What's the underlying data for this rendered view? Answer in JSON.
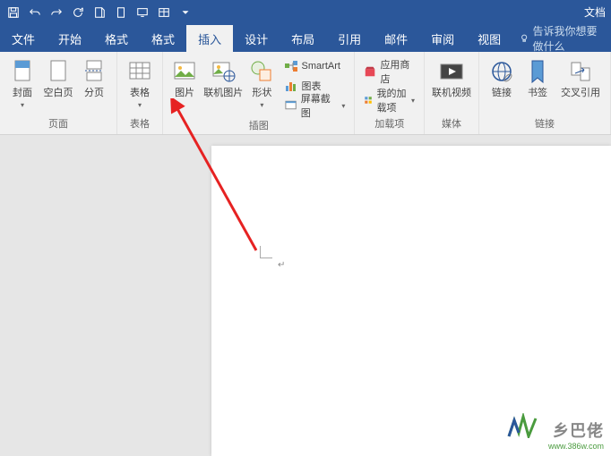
{
  "qat": {
    "doc_name": "文档"
  },
  "tabs": {
    "file": "文件",
    "start": "开始",
    "fmt1": "格式",
    "fmt2": "格式",
    "insert": "插入",
    "design": "设计",
    "layout": "布局",
    "ref": "引用",
    "mail": "邮件",
    "review": "审阅",
    "view": "视图",
    "tellme": "告诉我你想要做什么"
  },
  "ribbon": {
    "pages": {
      "cover": "封面",
      "blank": "空白页",
      "break": "分页",
      "label": "页面"
    },
    "table": {
      "btn": "表格",
      "label": "表格"
    },
    "illus": {
      "pic": "图片",
      "online": "联机图片",
      "shapes": "形状",
      "smartart": "SmartArt",
      "chart": "图表",
      "screenshot": "屏幕截图",
      "label": "插图"
    },
    "addins": {
      "store": "应用商店",
      "my": "我的加载项",
      "label": "加载项"
    },
    "media": {
      "video": "联机视频",
      "label": "媒体"
    },
    "links": {
      "hyperlink": "链接",
      "bookmark": "书签",
      "xref": "交叉引用",
      "label": "链接"
    }
  },
  "watermark": {
    "text": "乡巴佬",
    "url": "www.386w.com"
  }
}
